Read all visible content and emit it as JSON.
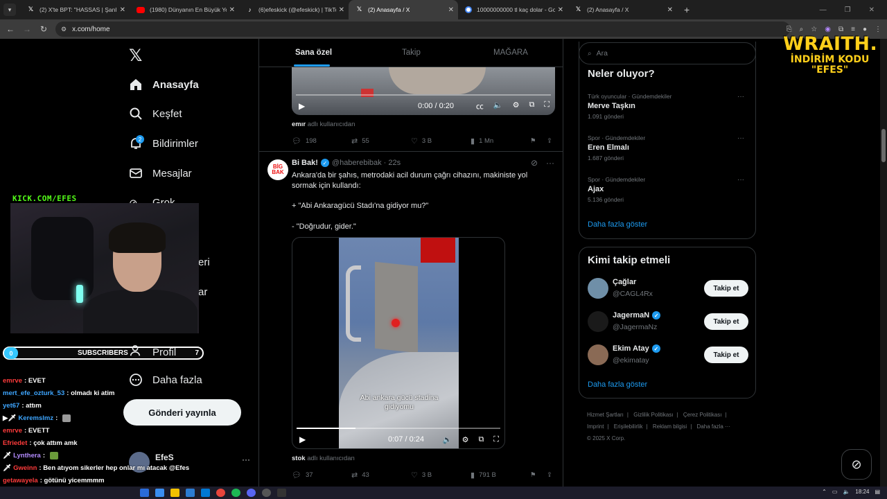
{
  "browser": {
    "tabs": [
      {
        "title": "(2) X'te BPT: \"HASSAS | Şanlıurfa",
        "favicon": "x-icon"
      },
      {
        "title": "(1980) Dünyanın En Büyük Yera",
        "favicon": "youtube-icon"
      },
      {
        "title": "(6)efeskick (@efeskick) | TikTok",
        "favicon": "tiktok-icon"
      },
      {
        "title": "(2) Anasayfa / X",
        "favicon": "x-icon",
        "active": true
      },
      {
        "title": "10000000000 tl kaç dolar - Goo",
        "favicon": "google-icon"
      },
      {
        "title": "(2) Anasayfa / X",
        "favicon": "x-icon"
      }
    ],
    "url": "x.com/home"
  },
  "x_nav": {
    "items": [
      {
        "label": "Anasayfa",
        "icon": "home-icon"
      },
      {
        "label": "Keşfet",
        "icon": "search-icon"
      },
      {
        "label": "Bildirimler",
        "icon": "bell-icon",
        "badge": "2"
      },
      {
        "label": "Mesajlar",
        "icon": "mail-icon"
      },
      {
        "label": "Grok",
        "icon": "grok-icon"
      }
    ],
    "partial_labels": [
      "eri",
      "ar"
    ],
    "profile": "Profil",
    "more": "Daha fazla",
    "post_button": "Gönderi yayınla",
    "account_name": "EfeS"
  },
  "stream": {
    "kick": "KICK.COM/EFES",
    "subs_left": "0",
    "subs_label": "SUBSCRIBERS",
    "subs_right": "7",
    "chat": [
      {
        "user": "emrve",
        "msg": "EVET",
        "color": "#ff3b3b"
      },
      {
        "user": "mert_efe_ozturk_53",
        "msg": "olmadı ki atim",
        "color": "#3ea6ff"
      },
      {
        "user": "yet67",
        "msg": "attım",
        "color": "#3ea6ff"
      },
      {
        "user": "Keremslmz",
        "msg": "",
        "color": "#3ea6ff",
        "prefix": "▶🗡",
        "emote": "#9a9a9a"
      },
      {
        "user": "emrve",
        "msg": "EVETT",
        "color": "#ff3b3b"
      },
      {
        "user": "Efriedet",
        "msg": "çok attım amk",
        "color": "#ff3b3b"
      },
      {
        "user": "Lynthera",
        "msg": "",
        "color": "#b48cff",
        "prefix": "🗡",
        "emote": "#6a9a3a"
      },
      {
        "user": "Gweinn",
        "msg": "Ben atıyom sikerler hep onlar mı atacak @Efes",
        "color": "#ff3b3b",
        "prefix": "🗡"
      },
      {
        "user": "getawayela",
        "msg": "götünü yicemmmm",
        "color": "#ff3b3b"
      }
    ],
    "sponsor_title": "WRAITH.",
    "sponsor_line1": "İNDİRİM KODU",
    "sponsor_line2": "\"EFES\""
  },
  "feed": {
    "tabs": [
      "Sana özel",
      "Takip",
      "MAĞARA"
    ],
    "post1": {
      "video_time": "0:00 / 0:20",
      "video_progress": 0.0,
      "credit_user": "emır",
      "credit_text": "adlı kullanıcıdan",
      "replies": "198",
      "reposts": "55",
      "likes": "3 B",
      "views": "1 Mn"
    },
    "post2": {
      "author": "Bi Bak!",
      "handle": "@haberebibak",
      "time": "22s",
      "avatar_text": "BİG BAK",
      "text": [
        "Ankara'da bir şahıs, metrodaki acil durum çağrı cihazını, makiniste yol sormak için kullandı:",
        "+ \"Abi Ankaragücü Stadı'na gidiyor mu?\"",
        "- \"Doğrudur, gider.\""
      ],
      "caption_line1": "Abi ankara gücü stadina",
      "caption_line2": "gidiyomu",
      "video_time": "0:07 / 0:24",
      "video_progress": 0.29,
      "credit_user": "stok",
      "credit_text": "adlı kullanıcıdan",
      "replies": "37",
      "reposts": "43",
      "likes": "3 B",
      "views": "791 B"
    }
  },
  "sidebar": {
    "search_placeholder": "Ara",
    "trends_title": "Neler oluyor?",
    "trends": [
      {
        "category": "Türk oyuncular · Gündemdekiler",
        "name": "Merve Taşkın",
        "count": "1.091 gönderi"
      },
      {
        "category": "Spor · Gündemdekiler",
        "name": "Eren Elmalı",
        "count": "1.687 gönderi"
      },
      {
        "category": "Spor · Gündemdekiler",
        "name": "Ajax",
        "count": "5.136 gönderi"
      }
    ],
    "show_more": "Daha fazla göster",
    "who_title": "Kimi takip etmeli",
    "who": [
      {
        "name": "Çağlar",
        "handle": "@CAGL4Rx",
        "verified": false,
        "avatar_color": "#6f8fa8"
      },
      {
        "name": "JagermaN",
        "handle": "@JagermaNz",
        "verified": true,
        "avatar_color": "#1a1a1a"
      },
      {
        "name": "Ekim Atay",
        "handle": "@ekimatay",
        "verified": true,
        "avatar_color": "#8a6a55"
      }
    ],
    "follow_label": "Takip et",
    "footer": [
      "Hizmet Şartları",
      "Gizlilik Politikası",
      "Çerez Politikası",
      "Imprint",
      "Erişilebilirlik",
      "Reklam bilgisi",
      "Daha fazla ···",
      "© 2025 X Corp."
    ]
  },
  "taskbar": {
    "time": "18:24"
  }
}
